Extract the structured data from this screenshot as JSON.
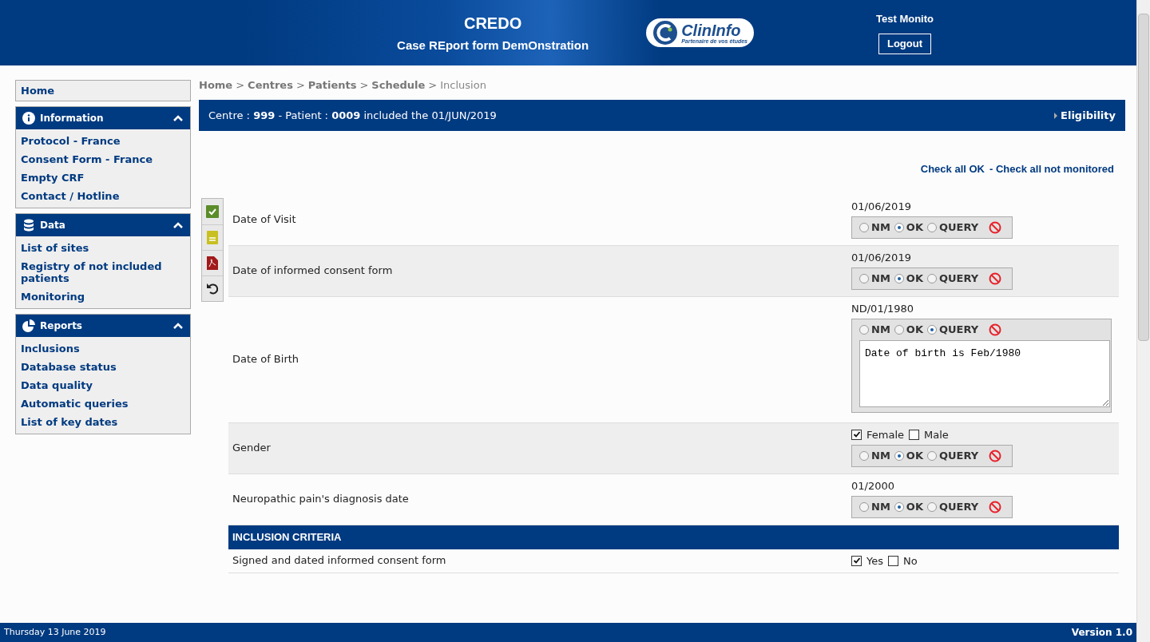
{
  "header": {
    "title": "CREDO",
    "subtitle": "Case REport form DemOnstration",
    "logo_name": "ClinInfo",
    "logo_tagline": "Partenaire de vos études",
    "user": "Test Monito",
    "logout": "Logout"
  },
  "sidebar": {
    "home": "Home",
    "sections": [
      {
        "title": "Information",
        "expanded": true,
        "items": [
          "Protocol - France",
          "Consent Form - France",
          "Empty CRF",
          "Contact / Hotline"
        ]
      },
      {
        "title": "Data",
        "expanded": true,
        "items": [
          "List of sites",
          "Registry of not included patients",
          "Monitoring"
        ]
      },
      {
        "title": "Reports",
        "expanded": true,
        "items": [
          "Inclusions",
          "Database status",
          "Data quality",
          "Automatic queries",
          "List of key dates"
        ]
      }
    ]
  },
  "breadcrumb": [
    {
      "label": "Home",
      "link": true
    },
    {
      "separator": ">",
      "label": "Centres",
      "link": true
    },
    {
      "separator": ">",
      "label": "Patients",
      "link": true
    },
    {
      "separator": ">",
      "label": "Schedule",
      "link": true
    },
    {
      "separator": ">",
      "label": "Inclusion",
      "link": false
    }
  ],
  "patient_bar": {
    "text": "Centre : **999** - Patient : **0009** included the 01/JUN/2019",
    "link": "Eligibility"
  },
  "check_links": [
    "Check all OK",
    "- Check all not monitored"
  ],
  "rows": [
    {
      "kind": "field",
      "label": "Date of Visit",
      "value": "01/06/2019",
      "monitor": [
        {
          "label": "NM",
          "selected": false
        },
        {
          "label": "OK",
          "selected": true
        },
        {
          "label": "QUERY",
          "selected": false
        }
      ]
    },
    {
      "kind": "field",
      "label": "Date of informed consent form",
      "value": "01/06/2019",
      "monitor": [
        {
          "label": "NM",
          "selected": false
        },
        {
          "label": "OK",
          "selected": true
        },
        {
          "label": "QUERY",
          "selected": false
        }
      ]
    },
    {
      "kind": "field",
      "label": "Date of Birth",
      "value": "ND/01/1980",
      "monitor": [
        {
          "label": "NM",
          "selected": false
        },
        {
          "label": "OK",
          "selected": false
        },
        {
          "label": "QUERY",
          "selected": true
        }
      ],
      "query": "Date of birth is Feb/1980"
    },
    {
      "kind": "checkbox",
      "label": "Gender",
      "options": [
        {
          "label": "Female",
          "checked": true
        },
        {
          "label": "Male",
          "checked": false
        }
      ],
      "monitor": [
        {
          "label": "NM",
          "selected": false
        },
        {
          "label": "OK",
          "selected": true
        },
        {
          "label": "QUERY",
          "selected": false
        }
      ]
    },
    {
      "kind": "field",
      "label": "Neuropathic pain's diagnosis date",
      "value": "01/2000",
      "monitor": [
        {
          "label": "NM",
          "selected": false
        },
        {
          "label": "OK",
          "selected": true
        },
        {
          "label": "QUERY",
          "selected": false
        }
      ]
    },
    {
      "kind": "section",
      "label": "INCLUSION CRITERIA"
    },
    {
      "kind": "checkbox",
      "label": "Signed and dated informed consent form",
      "options": [
        {
          "label": "Yes",
          "checked": true
        },
        {
          "label": "No",
          "checked": false
        }
      ]
    }
  ],
  "footer": {
    "date": "Thursday 13 June 2019",
    "version": "Version 1.0"
  }
}
